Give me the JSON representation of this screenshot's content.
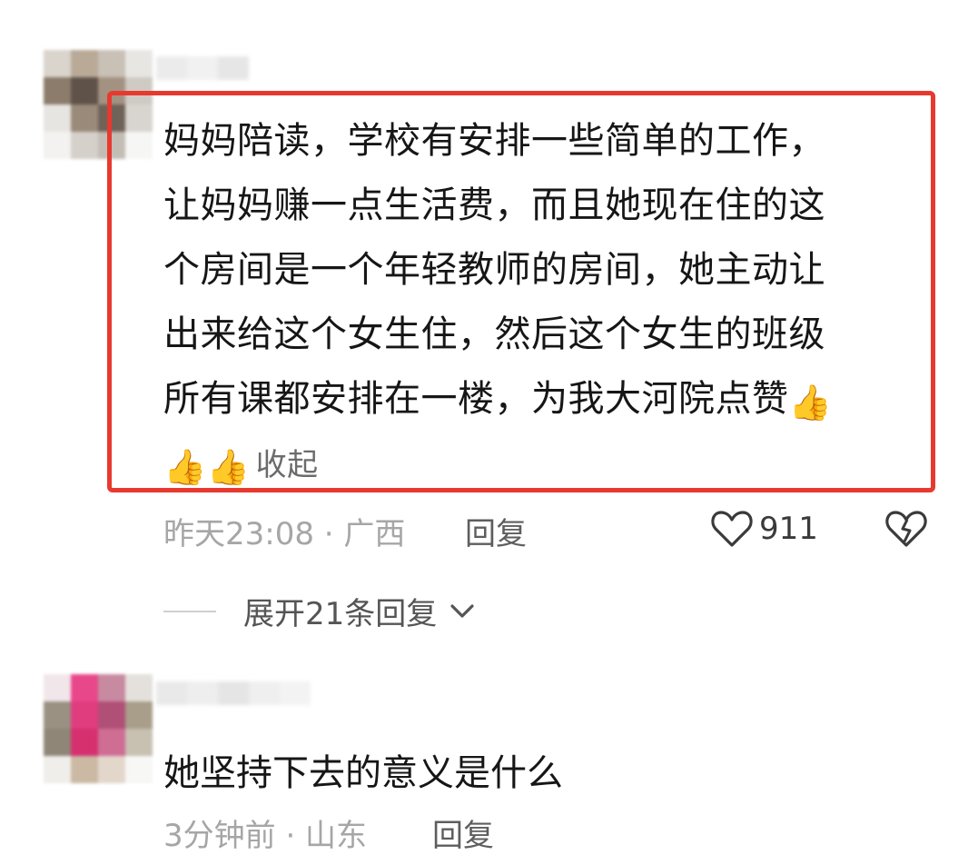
{
  "comment1": {
    "lines": [
      "妈妈陪读，学校有安排一些简单的工作，",
      "让妈妈赚一点生活费，而且她现在住的这",
      "个房间是一个年轻教师的房间，她主动让",
      "出来给这个女生住，然后这个女生的班级",
      "所有课都安排在一楼，为我大河院点赞"
    ],
    "thumb_emoji": "👍",
    "collapse_label": "收起",
    "time_location": "昨天23:08 · 广西",
    "reply_label": "回复",
    "like_count": "911",
    "icons": [
      "heart-icon",
      "broken-heart-icon",
      "thumbs-up-icon",
      "chevron-down-icon"
    ],
    "highlight_color": "#e8392f"
  },
  "expand_replies": {
    "label": "展开21条回复"
  },
  "comment2": {
    "text": "她坚持下去的意义是什么",
    "time_location": "3分钟前 · 山东",
    "reply_label": "回复"
  }
}
